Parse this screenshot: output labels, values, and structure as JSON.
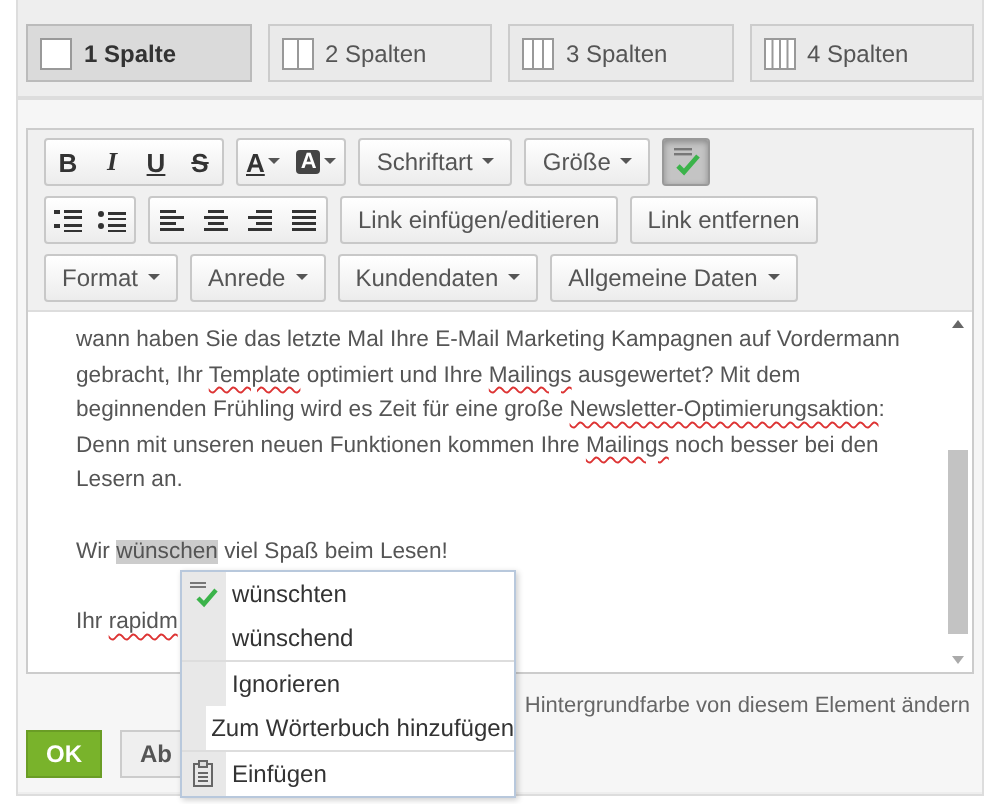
{
  "tabs": [
    {
      "label": "1 Spalte",
      "selected": true
    },
    {
      "label": "2 Spalten",
      "selected": false
    },
    {
      "label": "3 Spalten",
      "selected": false
    },
    {
      "label": "4 Spalten",
      "selected": false
    }
  ],
  "toolbar": {
    "rows": [
      [
        {
          "kind": "group",
          "items": [
            {
              "kind": "bold",
              "label": "B"
            },
            {
              "kind": "italic",
              "label": "I"
            },
            {
              "kind": "underline",
              "label": "U"
            },
            {
              "kind": "strike",
              "label": "S"
            }
          ]
        },
        {
          "kind": "group",
          "items": [
            {
              "kind": "text_color",
              "label": "A"
            },
            {
              "kind": "bg_color",
              "label": "A"
            }
          ]
        },
        {
          "kind": "dropdown",
          "label": "Schriftart"
        },
        {
          "kind": "dropdown",
          "label": "Größe"
        },
        {
          "kind": "spellcheck",
          "selected": true
        }
      ],
      [
        {
          "kind": "group",
          "items": [
            {
              "kind": "numbered_list"
            },
            {
              "kind": "bullet_list"
            }
          ]
        },
        {
          "kind": "group",
          "items": [
            {
              "kind": "align_left"
            },
            {
              "kind": "align_center"
            },
            {
              "kind": "align_right"
            },
            {
              "kind": "justify"
            }
          ]
        },
        {
          "kind": "button",
          "label": "Link einfügen/editieren"
        },
        {
          "kind": "button",
          "label": "Link entfernen"
        }
      ],
      [
        {
          "kind": "dropdown",
          "label": "Format"
        },
        {
          "kind": "dropdown",
          "label": "Anrede"
        },
        {
          "kind": "dropdown",
          "label": "Kundendaten"
        },
        {
          "kind": "dropdown",
          "label": "Allgemeine Daten"
        }
      ]
    ]
  },
  "content": {
    "paragraphs": [
      [
        {
          "text": "wann haben Sie das letzte Mal Ihre E-Mail Marketing Kampagnen auf Vordermann gebracht, Ihr ",
          "misspelled": false,
          "highlighted": false
        },
        {
          "text": "Template",
          "misspelled": true,
          "highlighted": false
        },
        {
          "text": " optimiert und Ihre ",
          "misspelled": false,
          "highlighted": false
        },
        {
          "text": "Mailings",
          "misspelled": true,
          "highlighted": false
        },
        {
          "text": " ausgewertet? Mit dem beginnenden Frühling wird es Zeit für eine große ",
          "misspelled": false,
          "highlighted": false
        },
        {
          "text": "Newsletter-Optimierungsaktion",
          "misspelled": true,
          "highlighted": false
        },
        {
          "text": ": Denn mit unseren neuen Funktionen kommen Ihre ",
          "misspelled": false,
          "highlighted": false
        },
        {
          "text": "Mailings",
          "misspelled": true,
          "highlighted": false
        },
        {
          "text": " noch besser bei den Lesern an.",
          "misspelled": false,
          "highlighted": false
        }
      ],
      [
        {
          "text": "Wir ",
          "misspelled": false,
          "highlighted": false
        },
        {
          "text": "wünschen",
          "misspelled": false,
          "highlighted": true
        },
        {
          "text": " viel Spaß beim Lesen!",
          "misspelled": false,
          "highlighted": false
        }
      ],
      [
        {
          "text": "Ihr ",
          "misspelled": false,
          "highlighted": false
        },
        {
          "text": "rapidm",
          "misspelled": true,
          "highlighted": false
        }
      ]
    ]
  },
  "context_menu": {
    "groups": [
      [
        {
          "label": "wünschten"
        },
        {
          "label": "wünschend"
        }
      ],
      [
        {
          "label": "Ignorieren"
        },
        {
          "label": "Zum Wörterbuch hinzufügen"
        }
      ],
      [
        {
          "label": "Einfügen"
        }
      ]
    ]
  },
  "background_link": "Hintergrundfarbe von diesem Element ändern",
  "buttons": [
    {
      "label": "OK",
      "kind": "primary"
    },
    {
      "label": "Ab",
      "kind": "secondary"
    }
  ]
}
